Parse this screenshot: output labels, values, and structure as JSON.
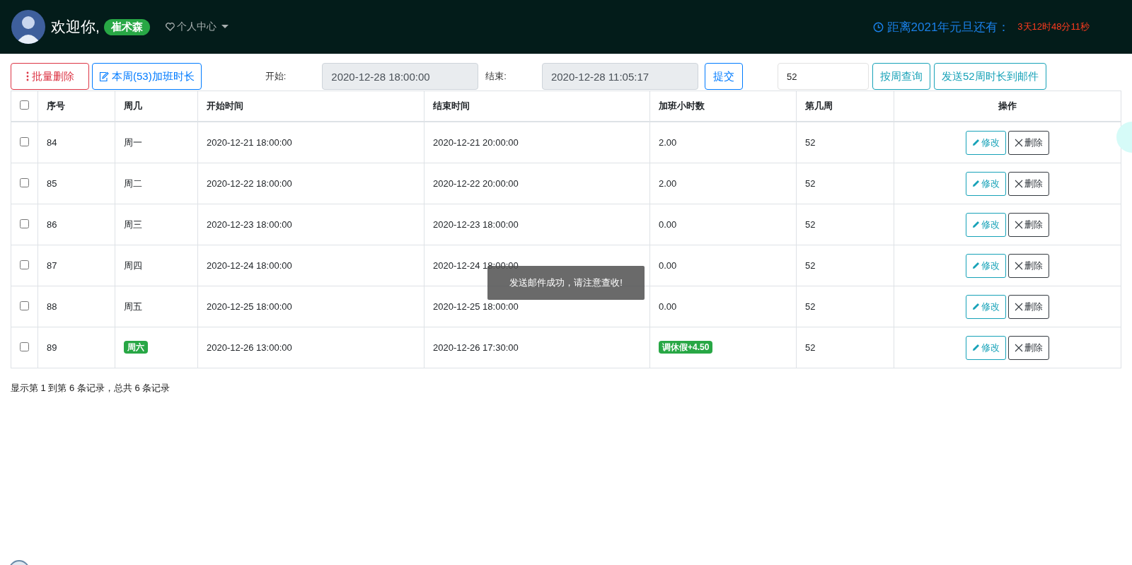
{
  "header": {
    "welcome": "欢迎你,",
    "user": "崔术森",
    "menu": "个人中心",
    "countdown_label": "距离2021年元旦还有：",
    "countdown_value": "3天12时48分11秒"
  },
  "toolbar": {
    "batch_delete": "批量删除",
    "week_hours": "本周(53)加班时长",
    "start_label": "开始:",
    "start_value": "2020-12-28 18:00:00",
    "end_label": "结束:",
    "end_value": "2020-12-28 11:05:17",
    "submit": "提交",
    "week_value": "52",
    "query": "按周查询",
    "send": "发送52周时长到邮件"
  },
  "table": {
    "select_all_checked": false,
    "columns": [
      "序号",
      "周几",
      "开始时间",
      "结束时间",
      "加班小时数",
      "第几周",
      "操作"
    ],
    "rows": [
      {
        "checked": false,
        "id": "84",
        "weekday": "周一",
        "weekday_highlight": false,
        "start": "2020-12-21 18:00:00",
        "end": "2020-12-21 20:00:00",
        "hours": "2.00",
        "hours_highlight": false,
        "week": "52",
        "actions": [
          "修改",
          "删除"
        ]
      },
      {
        "checked": false,
        "id": "85",
        "weekday": "周二",
        "weekday_highlight": false,
        "start": "2020-12-22 18:00:00",
        "end": "2020-12-22 20:00:00",
        "hours": "2.00",
        "hours_highlight": false,
        "week": "52",
        "actions": [
          "修改",
          "删除"
        ]
      },
      {
        "checked": false,
        "id": "86",
        "weekday": "周三",
        "weekday_highlight": false,
        "start": "2020-12-23 18:00:00",
        "end": "2020-12-23 18:00:00",
        "hours": "0.00",
        "hours_highlight": false,
        "week": "52",
        "actions": [
          "修改",
          "删除"
        ]
      },
      {
        "checked": false,
        "id": "87",
        "weekday": "周四",
        "weekday_highlight": false,
        "start": "2020-12-24 18:00:00",
        "end": "2020-12-24 18:00:00",
        "hours": "0.00",
        "hours_highlight": false,
        "week": "52",
        "actions": [
          "修改",
          "删除"
        ]
      },
      {
        "checked": false,
        "id": "88",
        "weekday": "周五",
        "weekday_highlight": false,
        "start": "2020-12-25 18:00:00",
        "end": "2020-12-25 18:00:00",
        "hours": "0.00",
        "hours_highlight": false,
        "week": "52",
        "actions": [
          "修改",
          "删除"
        ]
      },
      {
        "checked": false,
        "id": "89",
        "weekday": "周六",
        "weekday_highlight": true,
        "start": "2020-12-26 13:00:00",
        "end": "2020-12-26 17:30:00",
        "hours": "调休假+4.50",
        "hours_highlight": true,
        "week": "52",
        "actions": [
          "修改",
          "删除"
        ]
      }
    ]
  },
  "footer": "显示第 1 到第 6 条记录，总共 6 条记录",
  "toast": "发送邮件成功，请注意查收!"
}
